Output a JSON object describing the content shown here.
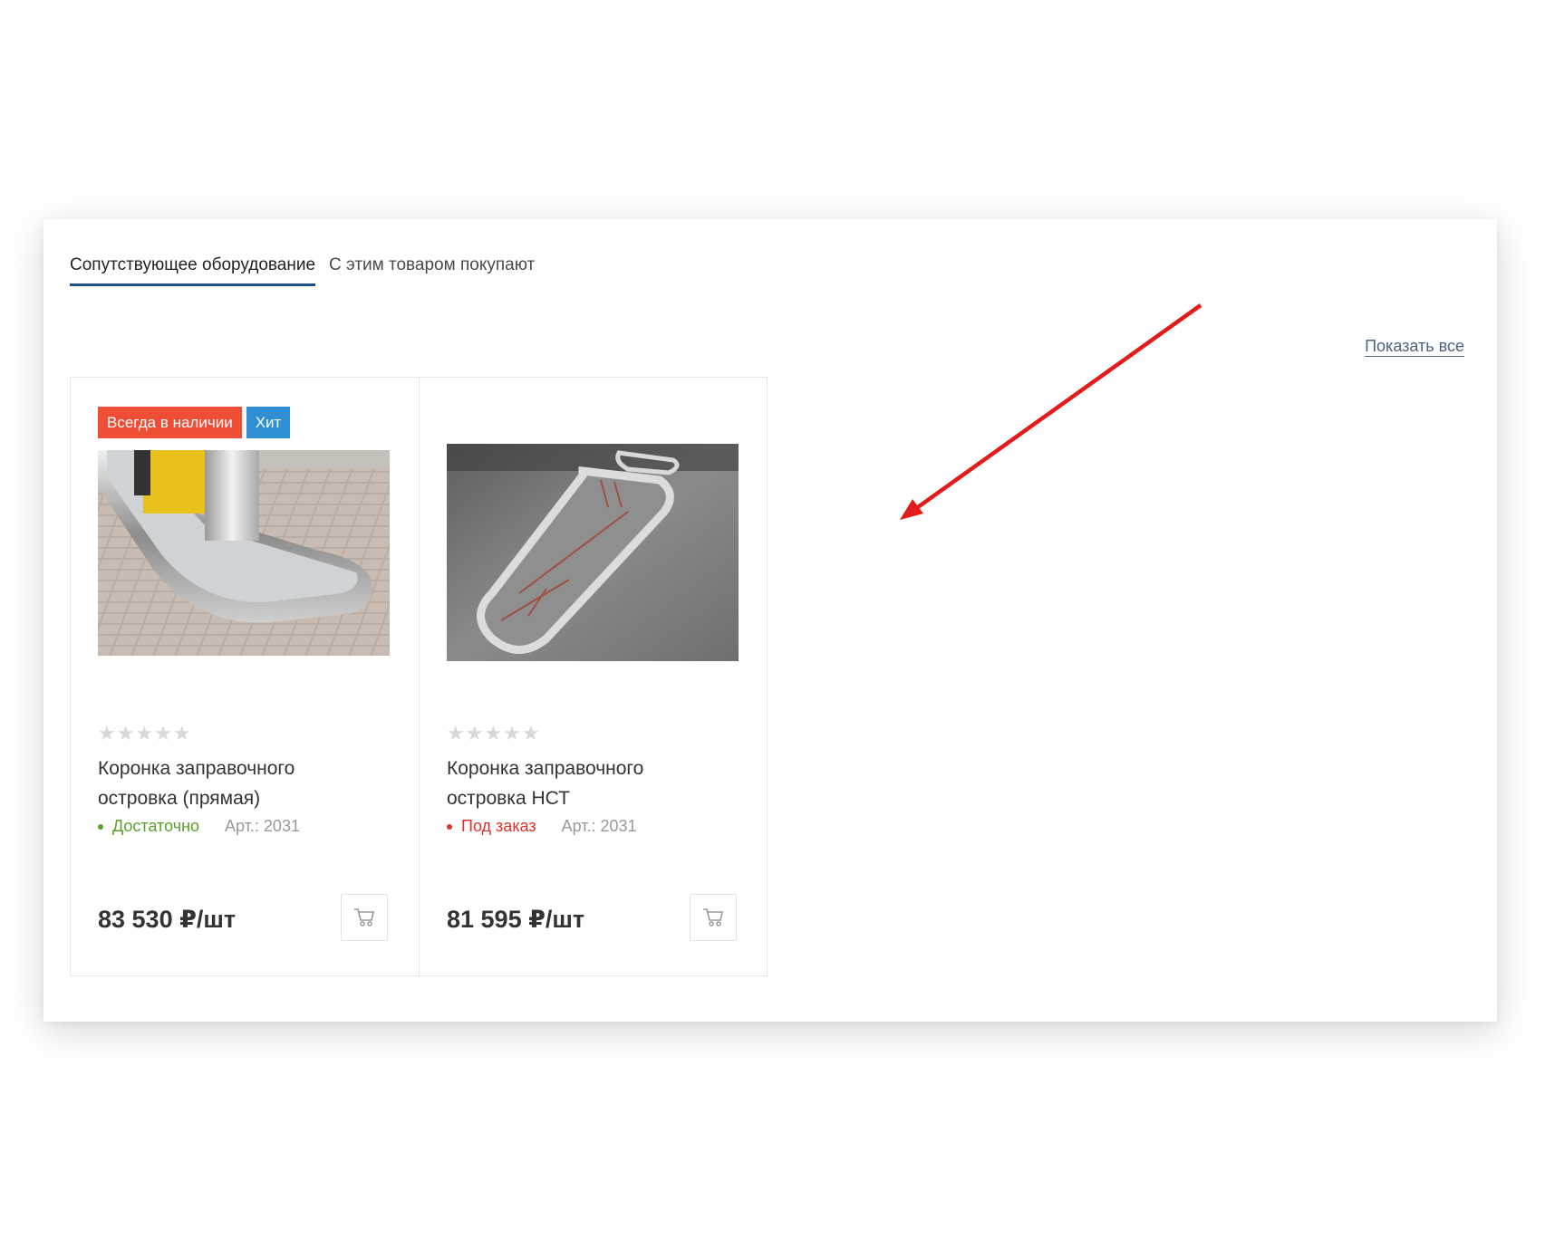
{
  "tabs": [
    {
      "label": "Сопутствующее оборудование",
      "active": true
    },
    {
      "label": "С этим товаром покупают",
      "active": false
    }
  ],
  "show_all": "Показать все",
  "products": [
    {
      "badges": [
        {
          "text": "Всегда в наличии",
          "color": "#ee4e36"
        },
        {
          "text": "Хит",
          "color": "#2f8fd6"
        }
      ],
      "stars": "★★★★★",
      "name": "Коронка заправочного островка (прямая)",
      "stock": "Достаточно",
      "stock_color": "#5aa02c",
      "sku": "Арт.: 2031",
      "price": "83 530 ₽/шт"
    },
    {
      "badges": [],
      "stars": "★★★★★",
      "name": "Коронка заправочного островка НСТ",
      "stock": "Под заказ",
      "stock_color": "#e0312a",
      "sku": "Арт.: 2031",
      "price": "81 595 ₽/шт"
    }
  ],
  "annotation_color": "#e41b1b"
}
